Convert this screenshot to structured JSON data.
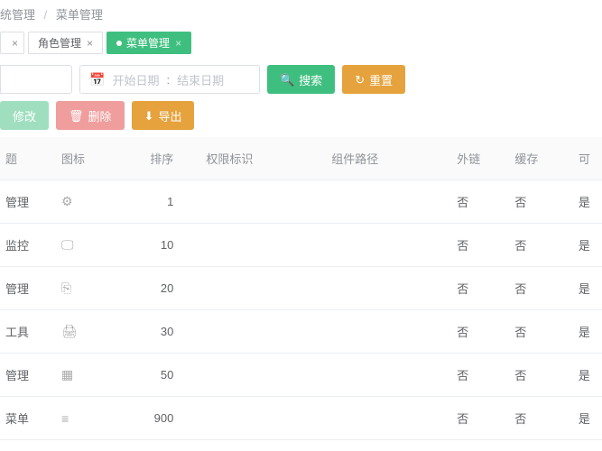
{
  "breadcrumb": {
    "part1": "统管理",
    "sep": "/",
    "part2": "菜单管理"
  },
  "tabs": [
    {
      "label": "角色管理",
      "active": false
    },
    {
      "label": "菜单管理",
      "active": true
    }
  ],
  "filters": {
    "name_placeholder": "",
    "date_start": "开始日期",
    "date_sep": ":",
    "date_end": "结束日期"
  },
  "buttons": {
    "search": "搜索",
    "reset": "重置",
    "edit": "修改",
    "delete": "删除",
    "export": "导出"
  },
  "columns": {
    "title": "题",
    "icon": "图标",
    "sort": "排序",
    "perm": "权限标识",
    "path": "组件路径",
    "ext": "外链",
    "cache": "缓存",
    "vis": "可"
  },
  "rows": [
    {
      "title": "管理",
      "icon": "⚙",
      "sort": "1",
      "perm": "",
      "path": "",
      "ext": "否",
      "cache": "否",
      "vis": "是"
    },
    {
      "title": "监控",
      "icon": "🖵",
      "sort": "10",
      "perm": "",
      "path": "",
      "ext": "否",
      "cache": "否",
      "vis": "是"
    },
    {
      "title": "管理",
      "icon": "⎘",
      "sort": "20",
      "perm": "",
      "path": "",
      "ext": "否",
      "cache": "否",
      "vis": "是"
    },
    {
      "title": "工具",
      "icon": "🖨",
      "sort": "30",
      "perm": "",
      "path": "",
      "ext": "否",
      "cache": "否",
      "vis": "是"
    },
    {
      "title": "管理",
      "icon": "▦",
      "sort": "50",
      "perm": "",
      "path": "",
      "ext": "否",
      "cache": "否",
      "vis": "是"
    },
    {
      "title": "菜单",
      "icon": "≡",
      "sort": "900",
      "perm": "",
      "path": "",
      "ext": "否",
      "cache": "否",
      "vis": "是"
    }
  ]
}
